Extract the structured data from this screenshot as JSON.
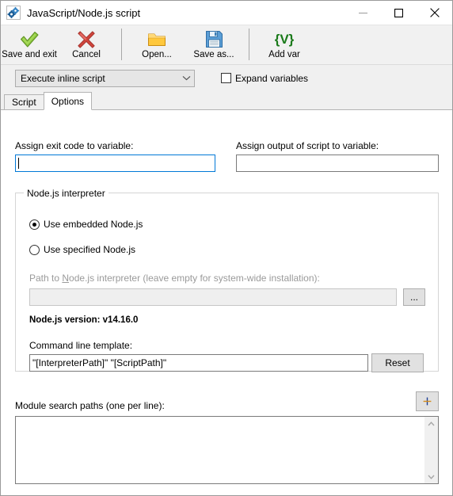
{
  "window": {
    "title": "JavaScript/Node.js script",
    "icon": "gears-icon",
    "minimize_label": "Minimize",
    "maximize_label": "Maximize",
    "close_label": "Close"
  },
  "toolbar": {
    "items": [
      {
        "label": "Save and exit",
        "icon": "green-check-icon"
      },
      {
        "label": "Cancel",
        "icon": "red-x-icon"
      },
      {
        "label": "Open...",
        "icon": "folder-icon"
      },
      {
        "label": "Save as...",
        "icon": "floppy-disk-icon"
      },
      {
        "label": "Add var",
        "icon": "braces-v-glyph",
        "glyph": "{V}"
      }
    ]
  },
  "mode": {
    "combo_value": "Execute inline script",
    "combo_options": [
      "Execute inline script"
    ],
    "expand_variables_label": "Expand variables",
    "expand_variables_checked": false
  },
  "tabs": [
    {
      "label": "Script",
      "active": false
    },
    {
      "label": "Options",
      "active": true
    }
  ],
  "options": {
    "exit_code": {
      "label": "Assign exit code to variable:",
      "value": "",
      "focused": true
    },
    "output": {
      "label": "Assign output of script to variable:",
      "value": "",
      "focused": false
    },
    "interpreter_group": {
      "title": "Node.js interpreter",
      "radios": [
        {
          "label": "Use embedded Node.js",
          "checked": true
        },
        {
          "label": "Use specified Node.js",
          "checked": false
        }
      ],
      "path": {
        "label_before": "Path to ",
        "label_accel": "N",
        "label_after": "ode.js interpreter (leave empty for system-wide installation):",
        "value": "",
        "disabled": true,
        "browse_label": "..."
      },
      "version_text": "Node.js version: v14.16.0",
      "command_line": {
        "label": "Command line template:",
        "value": "\"[InterpreterPath]\" \"[ScriptPath]\"",
        "reset_label": "Reset"
      }
    },
    "module_paths": {
      "label": "Module search paths (one per line):",
      "value": "",
      "add_label": "+"
    }
  },
  "colors": {
    "accent_focus": "#0078d7",
    "toolbar_bg": "#f1f1f1",
    "page_bg": "#ffffff",
    "check_green": "#7bc043",
    "cancel_red": "#cc3b32",
    "folder_yellow": "#ffc13b",
    "floppy_blue": "#4a90d9",
    "addvar_green": "#1a7a1a"
  }
}
